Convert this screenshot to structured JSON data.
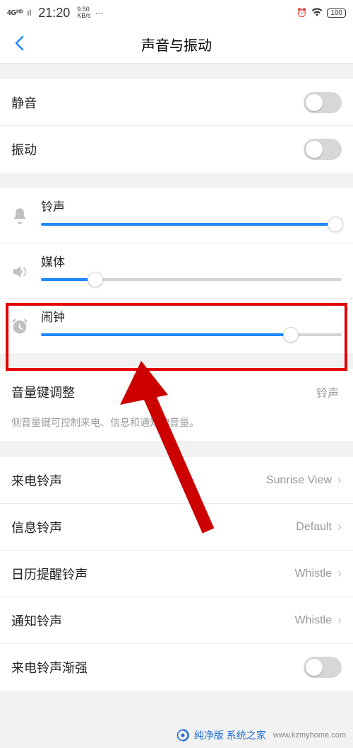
{
  "status": {
    "signal": "4Gᴴᴰ",
    "time": "21:20",
    "rate_top": "9.50",
    "rate_bot": "KB/s",
    "dots": "···",
    "battery": "100"
  },
  "header": {
    "title": "声音与振动"
  },
  "toggles": {
    "silent": "静音",
    "vibrate": "振动"
  },
  "sliders": {
    "ring": {
      "label": "铃声",
      "percent": 98
    },
    "media": {
      "label": "媒体",
      "percent": 18
    },
    "alarm": {
      "label": "闹钟",
      "percent": 83
    }
  },
  "volkey": {
    "label": "音量键调整",
    "value": "铃声",
    "desc": "侧音量键可控制来电、信息和通知的音量。"
  },
  "ringtones": {
    "incoming": {
      "label": "来电铃声",
      "value": "Sunrise View"
    },
    "message": {
      "label": "信息铃声",
      "value": "Default"
    },
    "calendar": {
      "label": "日历提醒铃声",
      "value": "Whistle"
    },
    "notify": {
      "label": "通知铃声",
      "value": "Whistle"
    },
    "ascending": {
      "label": "来电铃声渐强"
    }
  },
  "watermark": {
    "text": "纯净版 系统之家",
    "url": "www.kzmyhome.com"
  }
}
